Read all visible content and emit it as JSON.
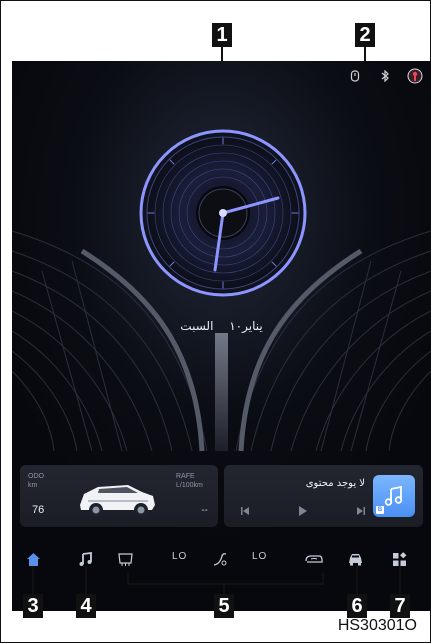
{
  "callouts": [
    "1",
    "2",
    "3",
    "4",
    "5",
    "6",
    "7"
  ],
  "document_code": "HS30301O",
  "screen": {
    "status_icons": [
      "usb-icon",
      "bluetooth-icon",
      "profile-icon"
    ],
    "clock": {
      "type": "analog",
      "hour_hand": "~3",
      "minute_hand": "~33"
    },
    "date": {
      "day_name": "السبت",
      "date_text": "يناير١٠"
    },
    "vehicle_card": {
      "odo_label_line1": "ODO",
      "odo_label_line2": "km",
      "odo_value": "76",
      "rafe_label_line1": "RAFE",
      "rafe_label_line2": "L/100km",
      "rafe_value": "--"
    },
    "media_card": {
      "title": "لا يوجد محتوى",
      "controls": [
        "previous-icon",
        "play-icon",
        "next-icon"
      ],
      "album_badge": "B"
    },
    "bottom_bar": {
      "items": [
        "home-icon",
        "music-icon",
        "rear-defrost-icon",
        "fan-icon",
        "recirculation-icon",
        "car-settings-icon",
        "apps-icon"
      ],
      "left_temp": "LO",
      "right_temp": "LO"
    }
  },
  "colors": {
    "screen_bg": "#07080d",
    "accent_blue": "#6f7dff",
    "home_active": "#5b8fe9",
    "album_blue": "#5b9cf7"
  }
}
